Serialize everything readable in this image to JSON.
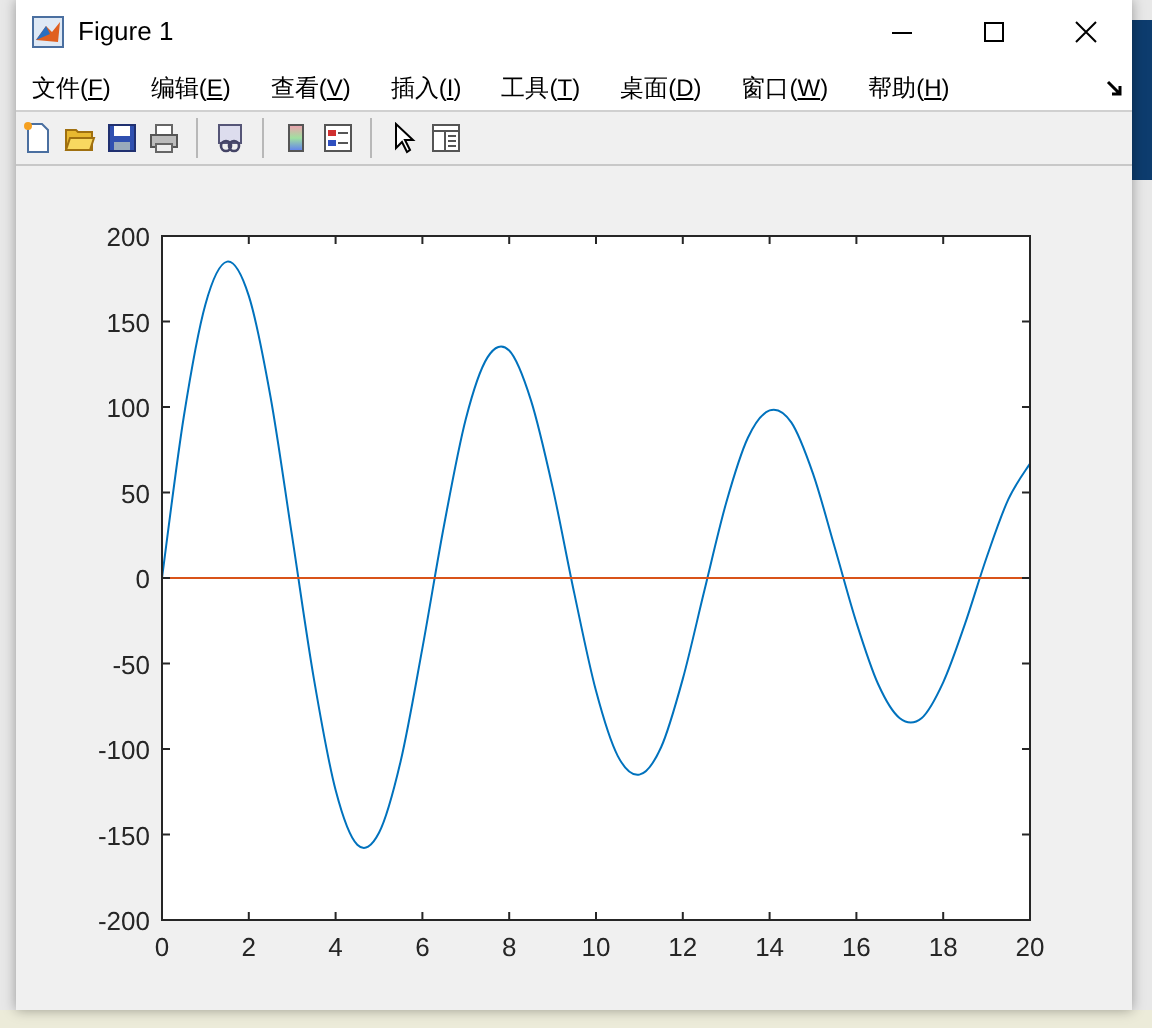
{
  "window": {
    "title": "Figure 1"
  },
  "menu": [
    {
      "label": "文件(F)"
    },
    {
      "label": "编辑(E)"
    },
    {
      "label": "查看(V)"
    },
    {
      "label": "插入(I)"
    },
    {
      "label": "工具(T)"
    },
    {
      "label": "桌面(D)"
    },
    {
      "label": "窗口(W)"
    },
    {
      "label": "帮助(H)"
    }
  ],
  "toolbar": [
    {
      "kind": "new"
    },
    {
      "kind": "open"
    },
    {
      "kind": "save"
    },
    {
      "kind": "print"
    },
    {
      "kind": "separator"
    },
    {
      "kind": "link"
    },
    {
      "kind": "separator"
    },
    {
      "kind": "colorbar"
    },
    {
      "kind": "legend"
    },
    {
      "kind": "separator"
    },
    {
      "kind": "pointer"
    },
    {
      "kind": "panel"
    }
  ],
  "chart_data": {
    "type": "line",
    "x": [
      0,
      0.5,
      1,
      1.5,
      2,
      2.5,
      3,
      3.5,
      4,
      4.5,
      5,
      5.5,
      6,
      6.5,
      7,
      7.5,
      8,
      8.5,
      9,
      9.5,
      10,
      10.5,
      11,
      11.5,
      12,
      12.5,
      13,
      13.5,
      14,
      14.5,
      15,
      15.5,
      16,
      16.5,
      17,
      17.5,
      18,
      18.5,
      19,
      19.5,
      20
    ],
    "series": [
      {
        "color": "#0072bd",
        "values": [
          0,
          94,
          160,
          185,
          165,
          106,
          24,
          -59,
          -124,
          -156,
          -149,
          -107,
          -41,
          31,
          93,
          129,
          133,
          104,
          53,
          -9,
          -66,
          -104,
          -115,
          -99,
          -59,
          -7,
          44,
          82,
          98,
          91,
          61,
          18,
          -26,
          -62,
          -82,
          -82,
          -61,
          -27,
          12,
          46,
          67
        ]
      },
      {
        "color": "#d95319",
        "values": [
          0,
          0,
          0,
          0,
          0,
          0,
          0,
          0,
          0,
          0,
          0,
          0,
          0,
          0,
          0,
          0,
          0,
          0,
          0,
          0,
          0,
          0,
          0,
          0,
          0,
          0,
          0,
          0,
          0,
          0,
          0,
          0,
          0,
          0,
          0,
          0,
          0,
          0,
          0,
          0,
          0
        ]
      }
    ],
    "xlim": [
      0,
      20
    ],
    "ylim": [
      -200,
      200
    ],
    "xticks": [
      0,
      2,
      4,
      6,
      8,
      10,
      12,
      14,
      16,
      18,
      20
    ],
    "yticks": [
      -200,
      -150,
      -100,
      -50,
      0,
      50,
      100,
      150,
      200
    ]
  }
}
